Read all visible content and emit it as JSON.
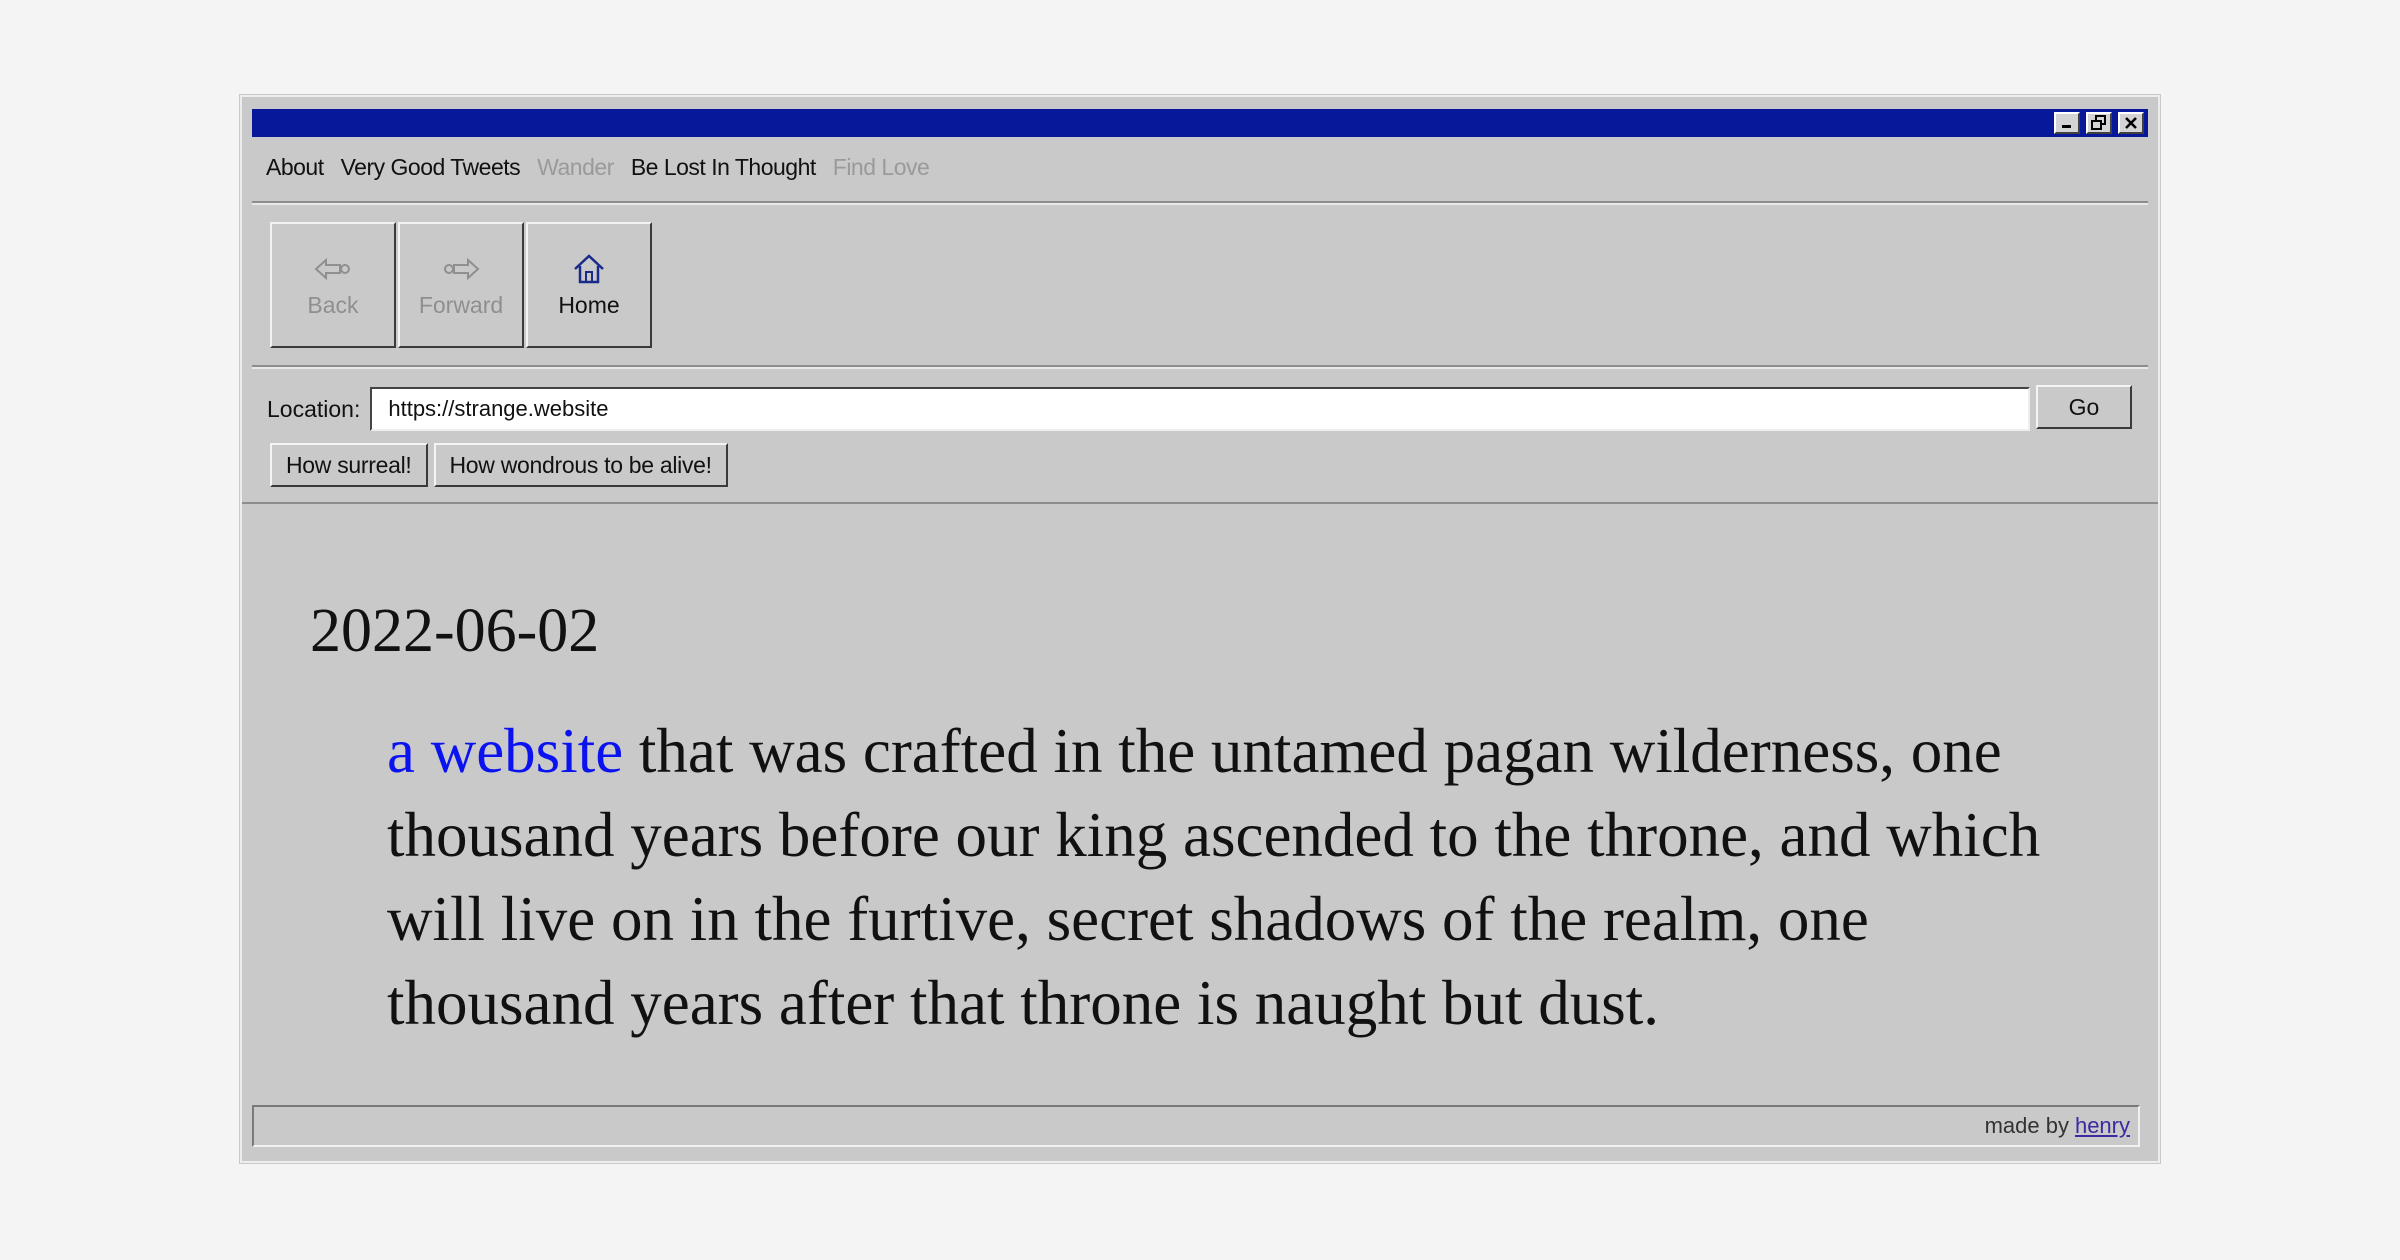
{
  "menu": {
    "items": [
      {
        "label": "About",
        "disabled": false
      },
      {
        "label": "Very Good Tweets",
        "disabled": false
      },
      {
        "label": "Wander",
        "disabled": true
      },
      {
        "label": "Be Lost In Thought",
        "disabled": false
      },
      {
        "label": "Find Love",
        "disabled": true
      }
    ]
  },
  "toolbar": {
    "back_label": "Back",
    "forward_label": "Forward",
    "home_label": "Home"
  },
  "location": {
    "label": "Location:",
    "value": "https://strange.website",
    "go_label": "Go"
  },
  "quick_buttons": {
    "surreal": "How surreal!",
    "wondrous": "How wondrous to be alive!"
  },
  "content": {
    "date": "2022-06-02",
    "link_text": "a website",
    "body_text": " that was crafted in the untamed pagan wilderness, one thousand years before our king ascended to the throne, and which will live on in the furtive, secret shadows of the realm, one thousand years after that throne is naught but dust."
  },
  "status": {
    "credit_prefix": "made by",
    "credit_link": "henry"
  },
  "colors": {
    "titlebar": "#08189a",
    "link": "#0a12f0",
    "chrome": "#c9c9c9"
  }
}
